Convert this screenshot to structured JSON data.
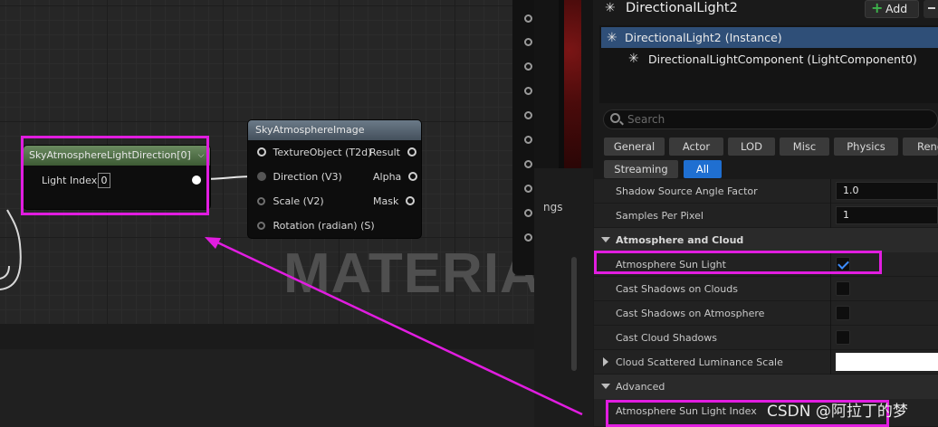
{
  "graph": {
    "watermark": "MATERIAL",
    "node_light": {
      "title": "SkyAtmosphereLightDirection[0]",
      "param_label": "Light Index",
      "param_value": "0"
    },
    "node_sky": {
      "title": "SkyAtmosphereImage",
      "inputs": [
        "TextureObject (T2d)",
        "Direction (V3)",
        "Scale (V2)",
        "Rotation (radian) (S)"
      ],
      "outputs": [
        "Result",
        "Alpha",
        "Mask"
      ]
    }
  },
  "mid_panel": {
    "tab_fragment": "ngs"
  },
  "details": {
    "title": "DirectionalLight2",
    "add_label": "Add",
    "tree": {
      "instance": "DirectionalLight2 (Instance)",
      "component": "DirectionalLightComponent (LightComponent0)"
    },
    "search_placeholder": "Search",
    "categories": [
      "General",
      "Actor",
      "LOD",
      "Misc",
      "Physics",
      "Rend",
      "Streaming",
      "All"
    ],
    "active_category": "All",
    "properties": {
      "shadow_source_angle_factor": {
        "label": "Shadow Source Angle Factor",
        "value": "1.0"
      },
      "samples_per_pixel": {
        "label": "Samples Per Pixel",
        "value": "1"
      },
      "section_atmosphere": "Atmosphere and Cloud",
      "atmosphere_sun_light": {
        "label": "Atmosphere Sun Light",
        "checked": true
      },
      "cast_shadows_on_clouds": {
        "label": "Cast Shadows on Clouds",
        "checked": false
      },
      "cast_shadows_on_atmosphere": {
        "label": "Cast Shadows on Atmosphere",
        "checked": false
      },
      "cast_cloud_shadows": {
        "label": "Cast Cloud Shadows",
        "checked": false
      },
      "cloud_scattered_luminance_scale": {
        "label": "Cloud Scattered Luminance Scale"
      },
      "section_advanced": "Advanced",
      "atmosphere_sun_light_index": {
        "label": "Atmosphere Sun Light Index"
      }
    }
  },
  "watermark_csdn": "CSDN @阿拉丁的梦",
  "colors": {
    "highlight": "#e11de0",
    "accent_blue": "#1f6fd1",
    "add_green": "#3db34b"
  },
  "icons": [
    "directional-light-icon",
    "plus-icon",
    "search-icon",
    "dropdown-icon",
    "checkmark-icon"
  ]
}
